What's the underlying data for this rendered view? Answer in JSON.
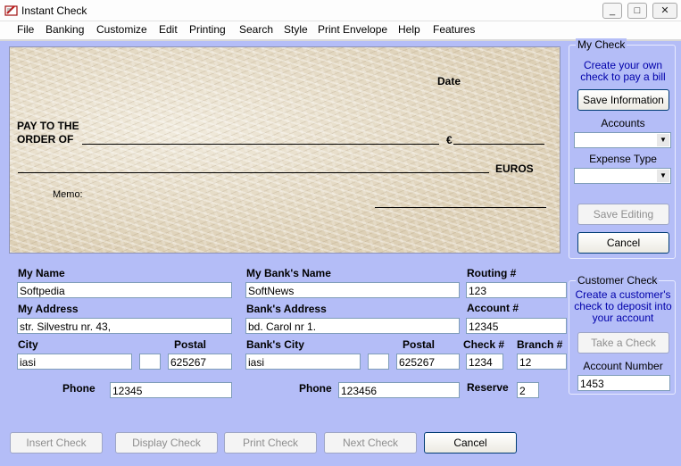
{
  "window": {
    "title": "Instant Check",
    "minimize": "_",
    "maximize": "□",
    "close": "✕"
  },
  "menu": [
    "File",
    "Banking",
    "Customize",
    "Edit",
    "Printing",
    "Search",
    "Style",
    "Print Envelope",
    "Help",
    "Features"
  ],
  "check": {
    "date_label": "Date",
    "pay_to_line1": "PAY TO THE",
    "pay_to_line2": "ORDER OF",
    "currency_symbol": "€",
    "currency_word": "EUROS",
    "memo_label": "Memo:"
  },
  "form": {
    "my_name": {
      "label": "My Name",
      "value": "Softpedia"
    },
    "my_address": {
      "label": "My Address",
      "value": "str. Silvestru nr. 43,"
    },
    "city": {
      "label": "City",
      "value": "iasi",
      "state": ""
    },
    "postal": {
      "label": "Postal",
      "value": "625267"
    },
    "phone": {
      "label": "Phone",
      "value": "12345"
    },
    "bank_name": {
      "label": "My Bank's Name",
      "value": "SoftNews"
    },
    "bank_address": {
      "label": "Bank's Address",
      "value": "bd. Carol nr 1."
    },
    "bank_city": {
      "label": "Bank's City",
      "value": "iasi",
      "state": ""
    },
    "bank_postal": {
      "label": "Postal",
      "value": "625267"
    },
    "bank_phone": {
      "label": "Phone",
      "value": "123456"
    },
    "routing": {
      "label": "Routing #",
      "value": "123"
    },
    "account": {
      "label": "Account #",
      "value": "12345"
    },
    "check_no": {
      "label": "Check #",
      "value": "1234"
    },
    "branch": {
      "label": "Branch #",
      "value": "12"
    },
    "reserve": {
      "label": "Reserve",
      "value": "2"
    }
  },
  "my_check": {
    "title": "My Check",
    "description": "Create your own check to pay a bill",
    "save_info": "Save Information",
    "accounts_label": "Accounts",
    "accounts_value": "",
    "expense_label": "Expense Type",
    "expense_value": "",
    "save_editing": "Save Editing",
    "cancel": "Cancel"
  },
  "customer_check": {
    "title": "Customer Check",
    "description": "Create a customer's check to deposit into your account",
    "take_check": "Take a Check",
    "account_number_label": "Account Number",
    "account_number_value": "1453"
  },
  "bottom": {
    "insert": "Insert Check",
    "display": "Display Check",
    "print": "Print Check",
    "next": "Next Check",
    "cancel": "Cancel"
  },
  "colors": {
    "background": "#b4bdf7",
    "check_paper": "#e6dcc7",
    "group_text": "#0000aa"
  }
}
